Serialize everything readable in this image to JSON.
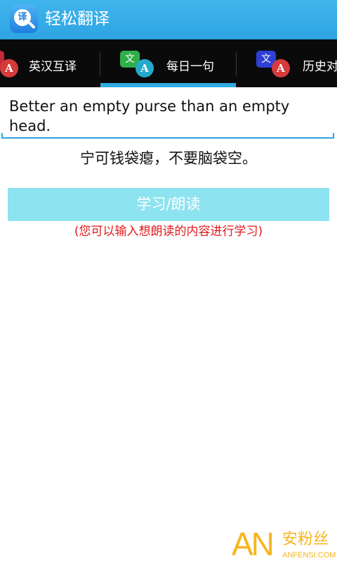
{
  "app": {
    "title": "轻松翻译",
    "icon_glyph": "译",
    "icon_name": "search-translate-icon"
  },
  "tabs": [
    {
      "label": "英汉互译",
      "icon_name": "translate-icon",
      "icon_back": "文",
      "icon_front": "A",
      "selected": false
    },
    {
      "label": "每日一句",
      "icon_name": "translate-icon",
      "icon_back": "文",
      "icon_front": "A",
      "selected": true
    },
    {
      "label": "历史对",
      "icon_name": "translate-icon",
      "icon_back": "文",
      "icon_front": "A",
      "selected": false
    }
  ],
  "daily": {
    "english": "Better an empty purse than an empty head.",
    "chinese": "宁可钱袋瘪，不要脑袋空。"
  },
  "learn_button": {
    "label": "学习/朗读"
  },
  "hint": "(您可以输入想朗读的内容进行学习)",
  "watermark": {
    "logo": "AN",
    "name": "安粉丝",
    "url": "ANFENSI.COM"
  },
  "colors": {
    "app_bar": "#2ea4e3",
    "tab_bar": "#0a0a0a",
    "tab_indicator": "#2eabe3",
    "button_bg": "#8de3ef",
    "hint_red": "#e3191c",
    "watermark": "#f6b51f"
  }
}
